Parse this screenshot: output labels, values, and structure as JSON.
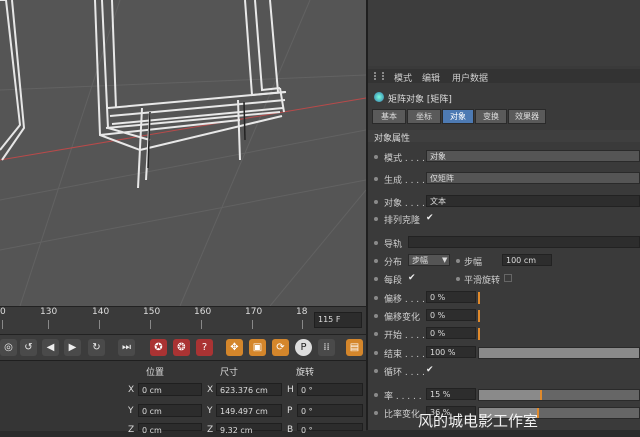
{
  "attributes_menu": {
    "items": [
      "模式",
      "编辑",
      "用户数据"
    ]
  },
  "object": {
    "title": "矩阵对象 [矩阵]"
  },
  "tabs": [
    {
      "label": "基本",
      "active": false
    },
    {
      "label": "坐标",
      "active": false
    },
    {
      "label": "对象",
      "active": true
    },
    {
      "label": "变换",
      "active": false
    },
    {
      "label": "效果器",
      "active": false
    }
  ],
  "section": {
    "title": "对象属性"
  },
  "props": {
    "mode": {
      "label": "模式 . . . .",
      "value": "对象"
    },
    "generate": {
      "label": "生成 . . . .",
      "value": "仅矩阵"
    },
    "object_field": {
      "label": "对象 . . . . .",
      "value": "文本"
    },
    "arrange_clones": {
      "label": "排列克隆",
      "checked": "✔"
    },
    "guide": {
      "label": "导轨",
      "value": ""
    },
    "distribute": {
      "label": "分布",
      "value": "步幅"
    },
    "step": {
      "label": "步幅",
      "value": "100 cm"
    },
    "per_segment": {
      "label": "每段",
      "checked": "✔"
    },
    "smooth_rotation": {
      "label": "平滑旋转",
      "checked": ""
    },
    "offset": {
      "label": "偏移 . . . .",
      "value": "0 %",
      "level": 0
    },
    "offset_variation": {
      "label": "偏移变化",
      "value": "0 %",
      "level": 0
    },
    "start": {
      "label": "开始 . . . .",
      "value": "0 %",
      "level": 0
    },
    "end": {
      "label": "结束 . . . .",
      "value": "100 %",
      "level": 100
    },
    "loop": {
      "label": "循环 . . . .",
      "checked": "✔"
    },
    "rate": {
      "label": "率 . . . . .",
      "value": "15 %",
      "level": 15
    },
    "rate_variation": {
      "label": "比率变化",
      "value": "36 %",
      "level": 36
    }
  },
  "timeline": {
    "ticks": [
      "0",
      "130",
      "140",
      "150",
      "160",
      "170",
      "18"
    ],
    "current_frame": "115 F"
  },
  "transport": {
    "buttons": [
      {
        "name": "record-icon",
        "glyph": "◎"
      },
      {
        "name": "loop-icon",
        "glyph": "↺"
      },
      {
        "name": "play-back-icon",
        "glyph": "◀"
      },
      {
        "name": "play-icon",
        "glyph": "▶"
      },
      {
        "name": "cycle-icon",
        "glyph": "↻"
      },
      {
        "name": "goto-end-icon",
        "glyph": "⏭"
      },
      {
        "name": "keyframe-add-icon",
        "glyph": "✪"
      },
      {
        "name": "keyframe-auto-icon",
        "glyph": "❂"
      },
      {
        "name": "help-icon",
        "glyph": "?"
      },
      {
        "name": "move-icon",
        "glyph": "✥"
      },
      {
        "name": "scale-icon",
        "glyph": "▣"
      },
      {
        "name": "rotate-icon",
        "glyph": "⟳"
      },
      {
        "name": "param-icon",
        "glyph": "P"
      },
      {
        "name": "dots-grid-icon",
        "glyph": "⁞⁞"
      },
      {
        "name": "filmstrip-icon",
        "glyph": "▤"
      }
    ]
  },
  "coords": {
    "headers": {
      "position": "位置",
      "size": "尺寸",
      "rotation": "旋转"
    },
    "rows": [
      {
        "pos_axis": "X",
        "pos": "0 cm",
        "size_axis": "X",
        "size": "623.376 cm",
        "rot_axis": "H",
        "rot": "0 °"
      },
      {
        "pos_axis": "Y",
        "pos": "0 cm",
        "size_axis": "Y",
        "size": "149.497 cm",
        "rot_axis": "P",
        "rot": "0 °"
      },
      {
        "pos_axis": "Z",
        "pos": "0 cm",
        "size_axis": "Z",
        "size": "9.32 cm",
        "rot_axis": "B",
        "rot": "0 °"
      }
    ]
  },
  "watermark": {
    "text": "风的城电影工作室"
  },
  "colors": {
    "accent": "#4d7ab3",
    "slider_mark": "#e08a2c",
    "viewport_bg": "#555555",
    "panel_bg": "#3a3a3a"
  }
}
